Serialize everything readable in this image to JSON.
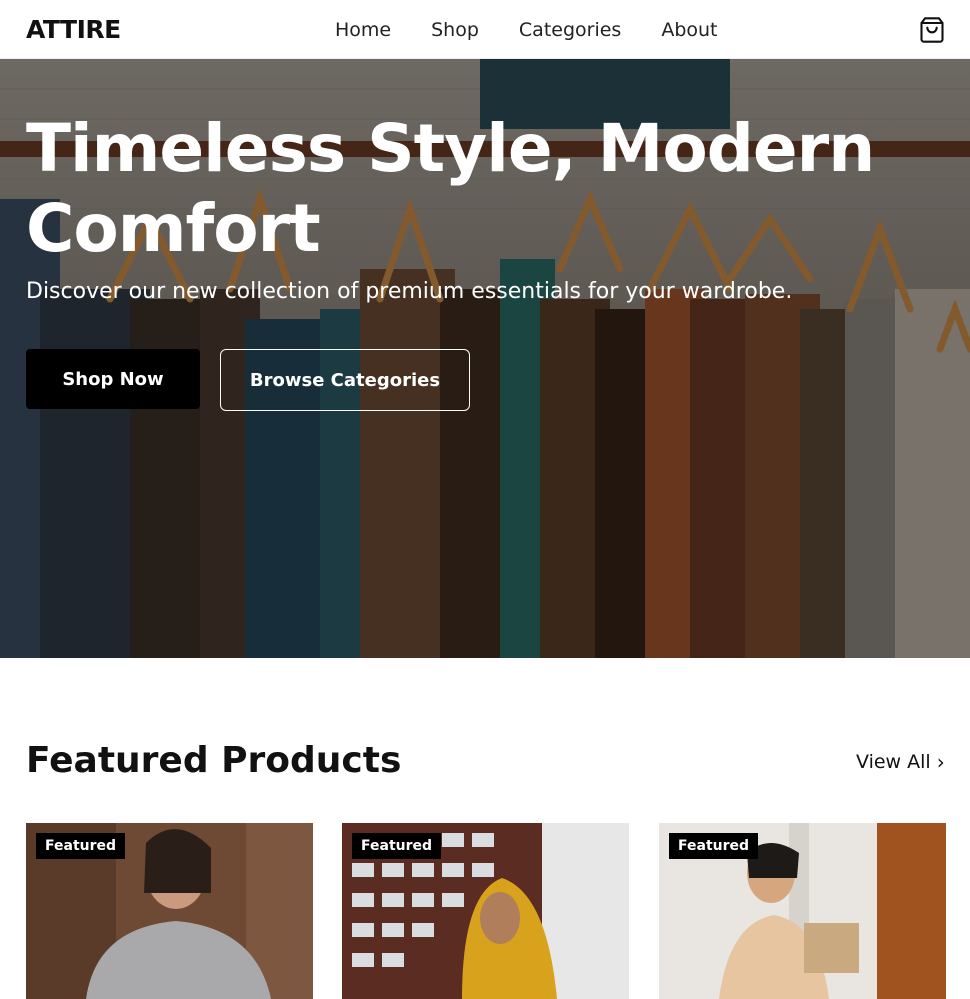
{
  "header": {
    "logo": "ATTIRE",
    "nav": [
      "Home",
      "Shop",
      "Categories",
      "About"
    ],
    "cart_icon": "shopping-bag-icon"
  },
  "hero": {
    "title": "Timeless Style, Modern Comfort",
    "subtitle": "Discover our new collection of premium essentials for your wardrobe.",
    "primary_button": "Shop Now",
    "secondary_button": "Browse Categories"
  },
  "featured": {
    "title": "Featured Products",
    "view_all": "View All",
    "chevron_icon": "chevron-right-icon",
    "cards": [
      {
        "badge": "Featured"
      },
      {
        "badge": "Featured"
      },
      {
        "badge": "Featured"
      }
    ]
  }
}
